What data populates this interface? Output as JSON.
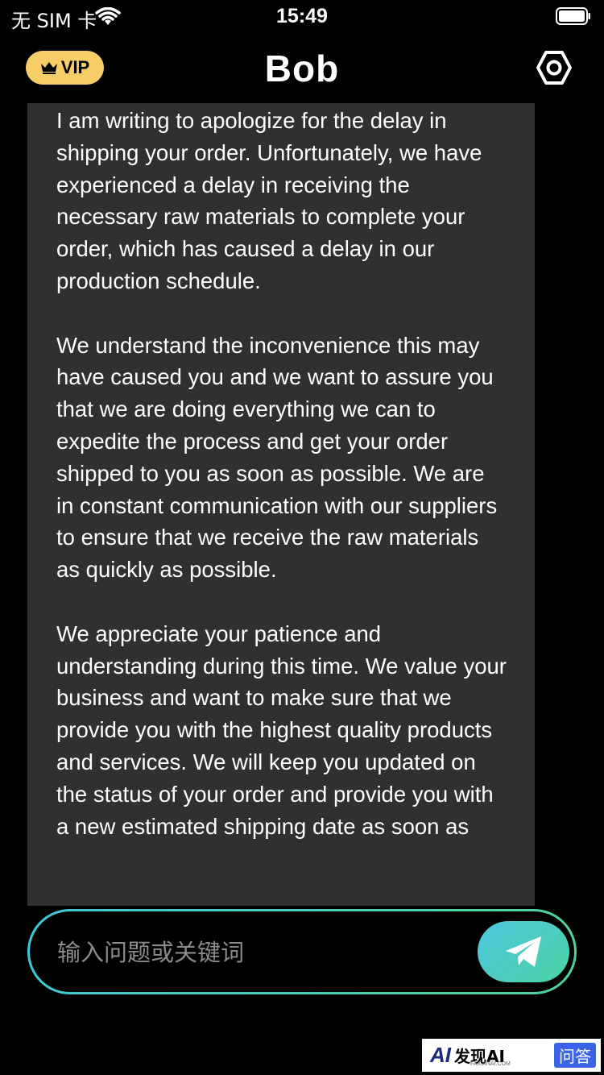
{
  "status_bar": {
    "carrier": "无 SIM 卡",
    "time": "15:49"
  },
  "header": {
    "vip_label": "VIP",
    "title": "Bob"
  },
  "message": {
    "text": "I am writing to apologize for the delay in shipping your order. Unfortunately, we have experienced a delay in receiving the necessary raw materials to complete your order, which has caused a delay in our production schedule.\n\nWe understand the inconvenience this may have caused you and we want to assure you that we are doing everything we can to expedite the process and get your order shipped to you as soon as possible. We are in constant communication with our suppliers to ensure that we receive the raw materials as quickly as possible.\n\nWe appreciate your patience and understanding during this time. We value your business and want to make sure that we provide you with the highest quality products and services. We will keep you updated on the status of your order and provide you with a new estimated shipping date as soon as"
  },
  "input": {
    "placeholder": "输入问题或关键词"
  },
  "watermark": {
    "logo": "AI",
    "text": "发现AI",
    "sub": "FAXIANAI.COM",
    "qa": "问答"
  },
  "icons": {
    "wifi": "wifi-icon",
    "battery": "battery-icon",
    "crown": "crown-icon",
    "settings": "settings-icon",
    "send": "send-icon"
  },
  "colors": {
    "vip_badge": "#f6cd66",
    "message_bg": "#2f3030",
    "accent_start": "#4fc6df",
    "accent_end": "#49d3a2"
  }
}
